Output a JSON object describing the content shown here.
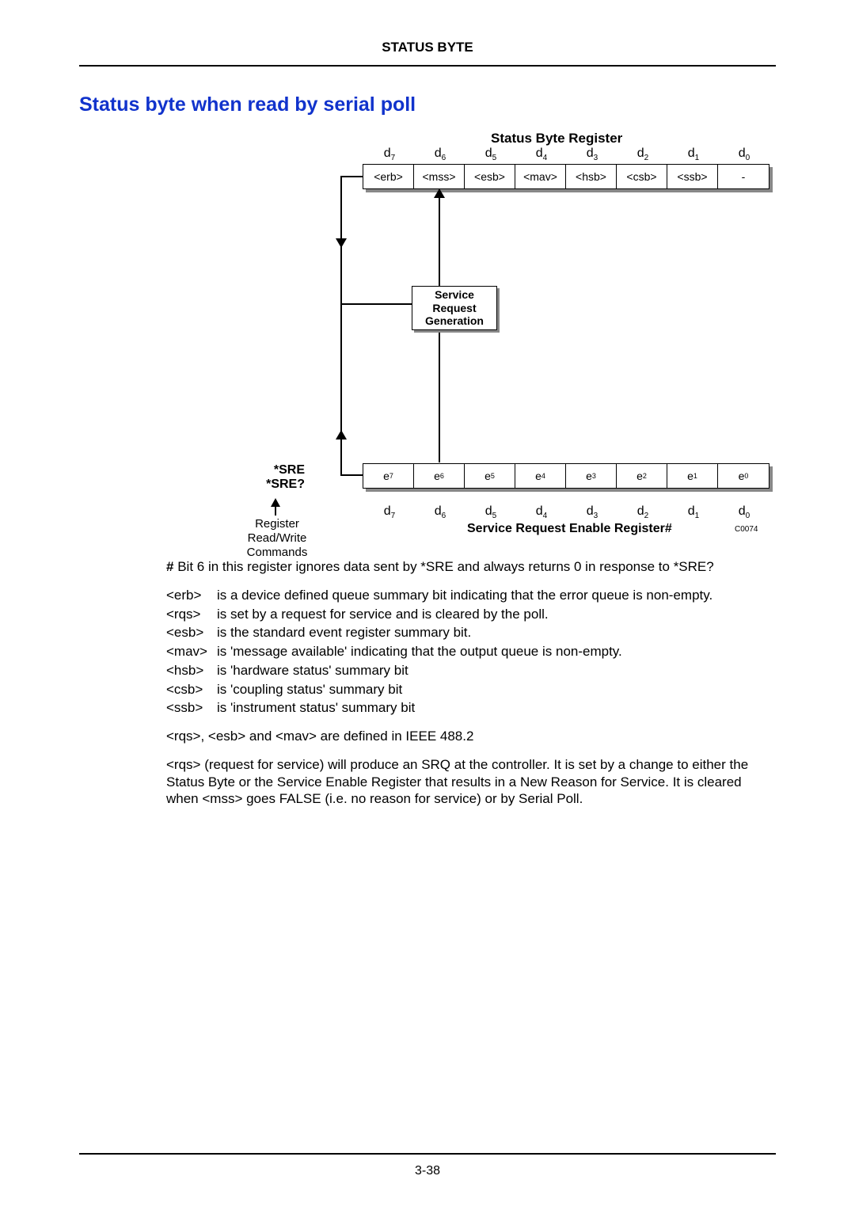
{
  "header": "STATUS BYTE",
  "title": "Status byte when read by serial poll",
  "diagram": {
    "sbr_title": "Status  Byte  Register",
    "d_labels": [
      "d",
      "d",
      "d",
      "d",
      "d",
      "d",
      "d",
      "d"
    ],
    "d_subs": [
      "7",
      "6",
      "5",
      "4",
      "3",
      "2",
      "1",
      "0"
    ],
    "top_cells": [
      "<erb>",
      "<mss>",
      "<esb>",
      "<mav>",
      "<hsb>",
      "<csb>",
      "<ssb>",
      "-"
    ],
    "srg_l1": "Service",
    "srg_l2": "Request",
    "srg_l3": "Generation",
    "sre_l1": "*SRE",
    "sre_l2": "*SRE?",
    "e_labels": [
      "e",
      "e",
      "e",
      "e",
      "e",
      "e",
      "e",
      "e"
    ],
    "e_subs": [
      "7",
      "6",
      "5",
      "4",
      "3",
      "2",
      "1",
      "0"
    ],
    "reg_l1": "Register",
    "reg_l2": "Read/Write",
    "reg_l3": "Commands",
    "srer_label": "Service  Request  Enable  Register#",
    "c_ref": "C0074"
  },
  "note_hash": "# Bit 6 in this register ignores data sent by *SRE and always returns 0 in response to *SRE?",
  "defs": [
    {
      "k": "<erb>",
      "v": "is a device defined queue summary bit indicating that the error queue is non-empty."
    },
    {
      "k": "<rqs>",
      "v": "is set by a request for service and is cleared by the poll."
    },
    {
      "k": "<esb>",
      "v": "is the standard event register summary bit."
    },
    {
      "k": "<mav>",
      "v": "is 'message available' indicating that the output queue is non-empty."
    },
    {
      "k": "<hsb>",
      "v": "is 'hardware status' summary bit"
    },
    {
      "k": "<csb>",
      "v": "is 'coupling status' summary bit"
    },
    {
      "k": "<ssb>",
      "v": "is 'instrument status' summary bit"
    }
  ],
  "ieee_line": "<rqs>, <esb> and <mav> are defined in IEEE 488.2",
  "rqs_para": "<rqs> (request for service) will produce an SRQ at the controller.  It is set by a change to either the Status Byte or the Service Enable Register that results in a New Reason for Service.  It is cleared when <mss> goes FALSE (i.e. no reason for service) or by Serial Poll.",
  "page_num": "3-38"
}
